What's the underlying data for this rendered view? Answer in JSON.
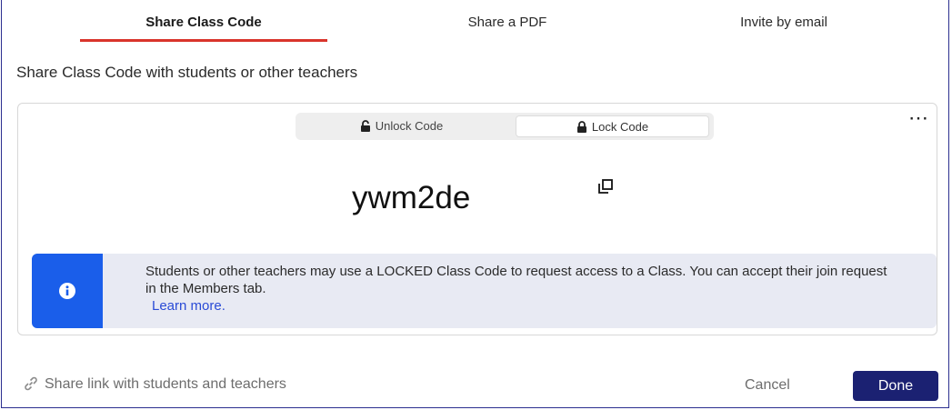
{
  "tabs": [
    {
      "label": "Share Class Code",
      "active": true
    },
    {
      "label": "Share a PDF",
      "active": false
    },
    {
      "label": "Invite by email",
      "active": false
    }
  ],
  "subtitle": "Share Class Code with students or other teachers",
  "card": {
    "toggle": {
      "unlock_label": "Unlock Code",
      "lock_label": "Lock Code",
      "selected": "lock"
    },
    "more_icon": "⋯",
    "class_code": "ywm2de",
    "info": {
      "text": "Students or other teachers may use a LOCKED Class Code to request access to a Class. You can accept their join request in the Members tab.",
      "link": "Learn more."
    }
  },
  "footer": {
    "share_link": "Share link with students and teachers",
    "cancel": "Cancel",
    "done": "Done"
  },
  "colors": {
    "accent_underline": "#d9342b",
    "info_side": "#1a5eea",
    "info_bg": "#e8eaf3",
    "done_button": "#1b2172",
    "frame_border": "#2b2f8f"
  },
  "icons": [
    "unlock-icon",
    "lock-icon",
    "more-icon",
    "copy-icon",
    "info-icon",
    "link-icon"
  ]
}
